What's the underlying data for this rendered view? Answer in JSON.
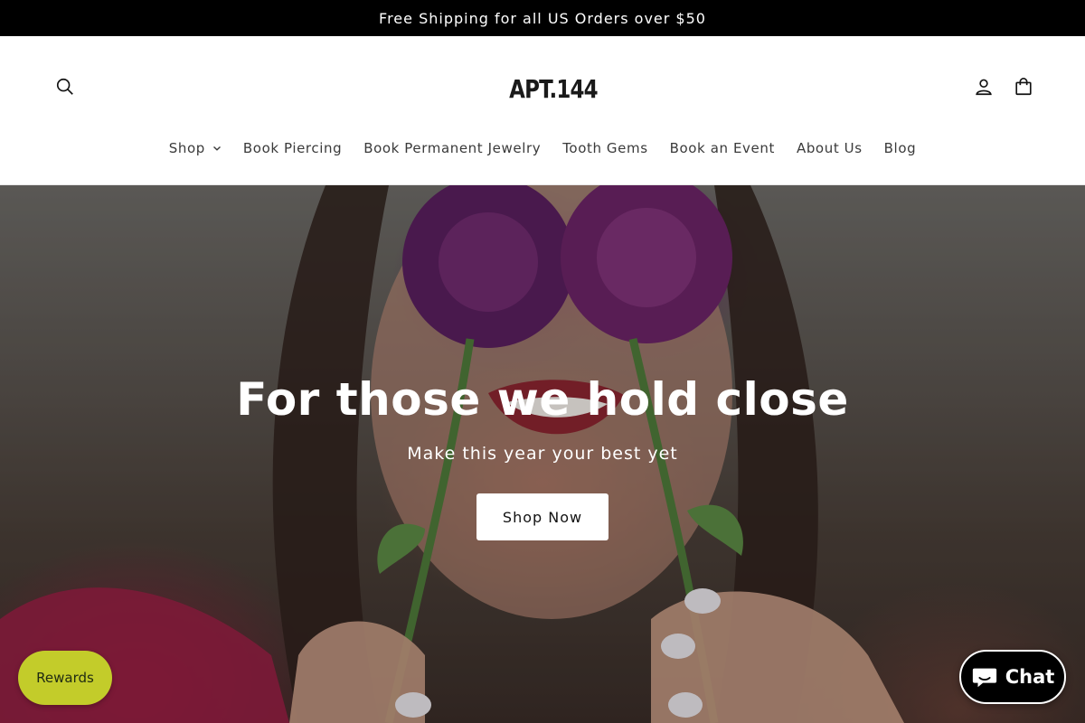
{
  "announcement": {
    "text": "Free Shipping for all US Orders over $50"
  },
  "header": {
    "logo": "APT.144",
    "icons": {
      "search": "search-icon",
      "account": "user-icon",
      "cart": "bag-icon"
    }
  },
  "nav": {
    "items": [
      {
        "label": "Shop",
        "has_dropdown": true
      },
      {
        "label": "Book Piercing"
      },
      {
        "label": "Book Permanent Jewelry"
      },
      {
        "label": "Tooth Gems"
      },
      {
        "label": "Book an Event"
      },
      {
        "label": "About Us"
      },
      {
        "label": "Blog"
      }
    ]
  },
  "hero": {
    "title": "For those we hold close",
    "subtitle": "Make this year your best yet",
    "button_label": "Shop Now",
    "image": "woman-holding-purple-flowers-over-eyes"
  },
  "widgets": {
    "rewards_label": "Rewards",
    "chat_label": "Chat",
    "rewards_color": "#c3cc2a",
    "chat_color": "#000000"
  }
}
